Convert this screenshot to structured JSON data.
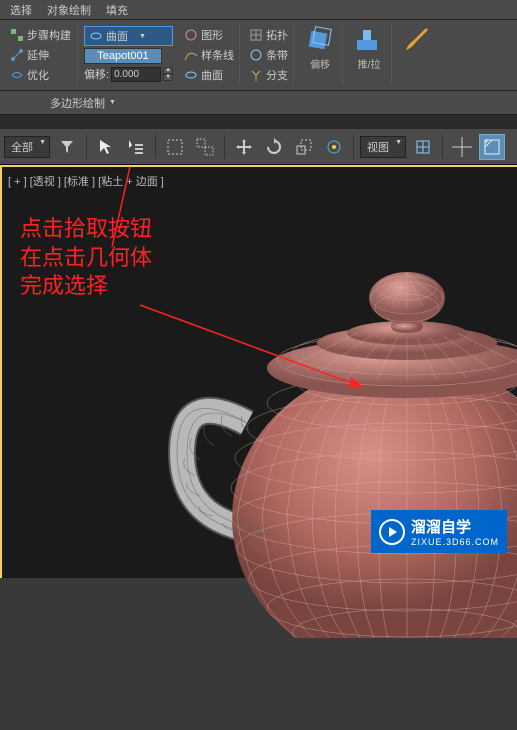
{
  "menu": {
    "item1": "选择",
    "item2": "对象绘制",
    "item3": "填充"
  },
  "ribbon": {
    "step_build": "步骤构建",
    "extend": "延伸",
    "optimize": "优化",
    "curve": "曲面",
    "teapot": "Teapot001",
    "offset_label": "偏移:",
    "offset_value": "0.000",
    "graphic": "图形",
    "splines": "样条线",
    "curve2": "曲面",
    "topology": "拓扑",
    "strips": "条带",
    "branch": "分支",
    "pianyi": "偏移",
    "tuila": "推/拉"
  },
  "secondary": {
    "polyedit": "多边形绘制"
  },
  "toolbar": {
    "all": "全部",
    "view": "视图"
  },
  "viewport": {
    "label": "[ + ] [透视 ] [标准 ] [粘土 + 边面 ]"
  },
  "annotation": {
    "line1": "点击拾取按钮",
    "line2": "在点击几何体",
    "line3": "完成选择"
  },
  "watermark": {
    "brand": "溜溜自学",
    "url": "ZIXUE.3D66.COM"
  }
}
